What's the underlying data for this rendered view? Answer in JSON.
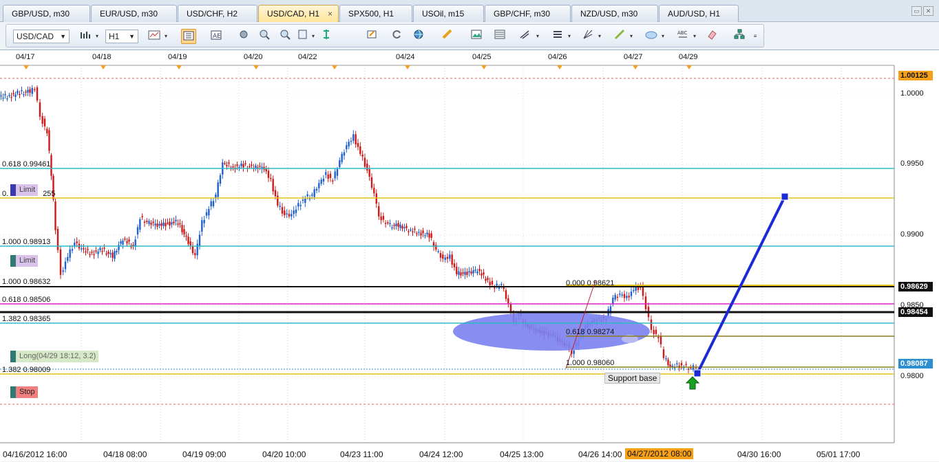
{
  "tabs": [
    {
      "label": "GBP/USD, m30"
    },
    {
      "label": "EUR/USD, m30"
    },
    {
      "label": "USD/CHF, H2"
    },
    {
      "label": "USD/CAD, H1",
      "active": true,
      "close": "×"
    },
    {
      "label": "SPX500, H1"
    },
    {
      "label": "USOil, m15"
    },
    {
      "label": "GBP/CHF, m30"
    },
    {
      "label": "NZD/USD, m30"
    },
    {
      "label": "AUD/USD, H1"
    }
  ],
  "toolbar": {
    "symbol": "USD/CAD",
    "timeframe": "H1",
    "icons": [
      "chart-type-icon",
      "chart-bars-icon",
      "depth-icon",
      "indicator-icon",
      "crosshair-icon",
      "zoom-in-icon",
      "zoom-out-icon",
      "template-icon",
      "globe-icon",
      "ruler-icon",
      "screenshot-icon",
      "image-icon",
      "fibonacci-icon",
      "hline-icon",
      "pitchfork-icon",
      "trendline-icon",
      "ellipse-icon",
      "text-icon",
      "eraser-icon",
      "objects-icon",
      "more-icon"
    ]
  },
  "chart": {
    "date_labels": [
      "04/17",
      "04/18",
      "04/19",
      "04/20",
      "04/22",
      "04/24",
      "04/25",
      "04/26",
      "04/27",
      "04/29"
    ],
    "time_labels": [
      "04/16/2012 16:00",
      "04/18 08:00",
      "04/19 09:00",
      "04/20 10:00",
      "04/23 11:00",
      "04/24 12:00",
      "04/25 13:00",
      "04/26 14:00",
      "04/30 16:00",
      "05/01 17:00"
    ],
    "current_time": "04/27/2012 08:00",
    "price_labels": [
      "1.0000",
      "0.9950",
      "0.9900",
      "0.9850",
      "0.9800"
    ],
    "price_tags": [
      {
        "text": "1.00125",
        "color": "#f6a01a",
        "text_color": "#111"
      },
      {
        "text": "0.98629",
        "color": "#111111",
        "text_color": "#ffffff"
      },
      {
        "text": "0.98454",
        "color": "#111111",
        "text_color": "#ffffff"
      },
      {
        "text": "0.98087",
        "color": "#2d8fd0",
        "text_color": "#ffffff"
      }
    ],
    "levels": [
      {
        "text": "0.618 0.99461"
      },
      {
        "text": "0.",
        "suffix": "255"
      },
      {
        "text": "1.000 0.98913"
      },
      {
        "text": "1.000 0.98632"
      },
      {
        "text": "0.618 0.98506"
      },
      {
        "text": "1.382 0.98365"
      },
      {
        "text": "1.382 0.98009"
      }
    ],
    "orders": [
      {
        "label": "Limit",
        "bar_color": "#3a3ab0",
        "bg": "#d9c3ea",
        "text_color": "#444"
      },
      {
        "label": "Limit",
        "bar_color": "#2f7a74",
        "bg": "#d9c3ea",
        "text_color": "#444"
      },
      {
        "label": "Long(04/29 18:12, 3.2)",
        "bar_color": "#2f7a74",
        "bg": "#d7e8c7",
        "text_color": "#666"
      },
      {
        "label": "Stop",
        "bar_color": "#2f7a74",
        "bg": "#f08080",
        "text_color": "#222"
      }
    ],
    "fib_annotations": [
      {
        "text": "0.000 0.98621"
      },
      {
        "text": "0.618 0.98274"
      },
      {
        "text": "1.000 0.98060"
      }
    ],
    "support_label": "Support base"
  }
}
